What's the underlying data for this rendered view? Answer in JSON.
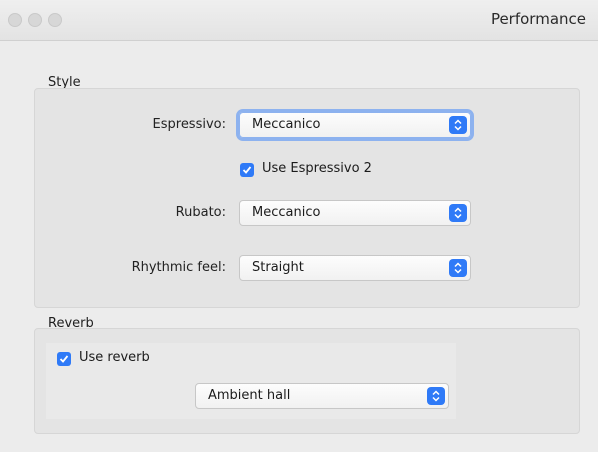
{
  "window": {
    "title": "Performance",
    "buttons": [
      "close",
      "minimize",
      "zoom"
    ]
  },
  "style_group": {
    "label": "Style",
    "espressivo": {
      "label": "Espressivo:",
      "value": "Meccanico"
    },
    "use_espressivo_2": {
      "label": "Use Espressivo 2",
      "checked": true
    },
    "rubato": {
      "label": "Rubato:",
      "value": "Meccanico"
    },
    "rhythmic_feel": {
      "label": "Rhythmic feel:",
      "value": "Straight"
    }
  },
  "reverb_group": {
    "label": "Reverb",
    "use_reverb": {
      "label": "Use reverb",
      "checked": true
    },
    "preset": {
      "value": "Ambient hall"
    }
  },
  "colors": {
    "accent": "#2f7af7",
    "focus_ring": "#8db2ef",
    "background": "#ececec"
  }
}
